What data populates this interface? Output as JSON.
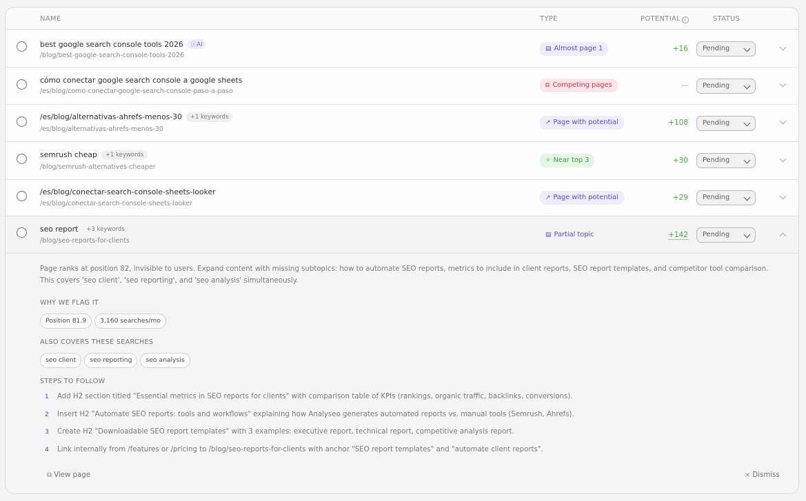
{
  "header": {
    "name": "NAME",
    "type": "TYPE",
    "potential": "POTENTIAL",
    "status": "STATUS",
    "info_icon": "i"
  },
  "rows": [
    {
      "title": "best google search console tools 2026",
      "tag": "AI",
      "tag_icon": "ⓘ",
      "path": "/blog/best-google-search-console-tools-2026",
      "type": "Almost page 1",
      "type_icon": "▤",
      "potential": "+16",
      "status": "Pending"
    },
    {
      "title": "cómo conectar google search console a google sheets",
      "path": "/es/blog/como-conectar-google-search-console-paso-a-paso",
      "type": "Competing pages",
      "type_icon": "⧉",
      "potential": "—",
      "status": "Pending"
    },
    {
      "title": "/es/blog/alternativas-ahrefs-menos-30",
      "tag": "+1 keywords",
      "path": "/es/blog/alternativas-ahrefs-menos-30",
      "type": "Page with potential",
      "type_icon": "↗",
      "potential": "+108",
      "status": "Pending"
    },
    {
      "title": "semrush cheap",
      "tag": "+1 keywords",
      "path": "/blog/semrush-alternatives-cheaper",
      "type": "Near top 3",
      "type_icon": "✧",
      "potential": "+30",
      "status": "Pending"
    },
    {
      "title": "/es/blog/conectar-search-console-sheets-looker",
      "path": "/es/blog/conectar-search-console-sheets-looker",
      "type": "Page with potential",
      "type_icon": "↗",
      "potential": "+29",
      "status": "Pending"
    },
    {
      "title": "seo report",
      "tag": "+3 keywords",
      "path": "/blog/seo-reports-for-clients",
      "type": "Partial topic",
      "type_icon": "▤",
      "potential": "+142",
      "status": "Pending"
    }
  ],
  "detail": {
    "description": "Page ranks at position 82, invisible to users. Expand content with missing subtopics: how to automate SEO reports, metrics to include in client reports, SEO report templates, and competitor tool comparison. This covers 'seo client', 'seo reporting', and 'seo analysis' simultaneously.",
    "why_label": "WHY WE FLAG IT",
    "why": [
      "Position 81.9",
      "3,160 searches/mo"
    ],
    "covers_label": "ALSO COVERS THESE SEARCHES",
    "covers": [
      "seo client",
      "seo reporting",
      "seo analysis"
    ],
    "steps_label": "STEPS TO FOLLOW",
    "steps": [
      {
        "n": "1",
        "text": "Add H2 section titled \"Essential metrics in SEO reports for clients\" with comparison table of KPIs (rankings, organic traffic, backlinks, conversions)."
      },
      {
        "n": "2",
        "text": "Insert H2 \"Automate SEO reports: tools and workflows\" explaining how Analyseo generates automated reports vs. manual tools (Semrush, Ahrefs)."
      },
      {
        "n": "3",
        "text": "Create H2 \"Downloadable SEO report templates\" with 3 examples: executive report, technical report, competitive analysis report."
      },
      {
        "n": "4",
        "text": "Link internally from /features or /pricing to /blog/seo-reports-for-clients with anchor \"SEO report templates\" and \"automate client reports\"."
      }
    ],
    "view_page": "View page",
    "view_icon": "⧉",
    "dismiss": "Dismiss",
    "dismiss_icon": "×"
  },
  "colors": {
    "accent": "#5b4cc7",
    "positive": "#4aa84a",
    "danger": "#d0334f"
  }
}
